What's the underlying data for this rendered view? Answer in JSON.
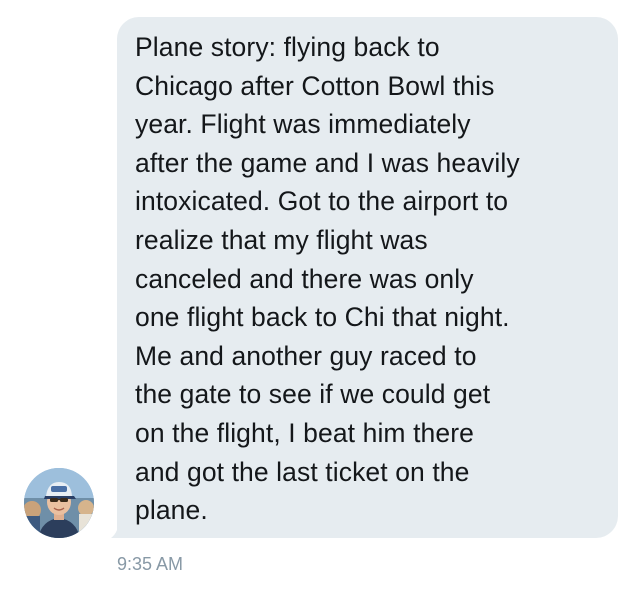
{
  "conversation": {
    "message": {
      "text": "Plane story: flying back to\nChicago after Cotton Bowl this\nyear. Flight was immediately\nafter the game and I was heavily\nintoxicated. Got to the airport to\nrealize that my flight was\ncanceled and there was only\none flight back to Chi that night.\nMe and another guy raced to\nthe gate to see if we could get\non the flight, I beat him there\nand got the last ticket on the\nplane.",
      "timestamp": "9:35 AM",
      "avatar_icon": "user-avatar-photo"
    },
    "colors": {
      "bubble_background": "#e6ecf0",
      "text": "#14171a",
      "timestamp": "#8899a6"
    }
  }
}
